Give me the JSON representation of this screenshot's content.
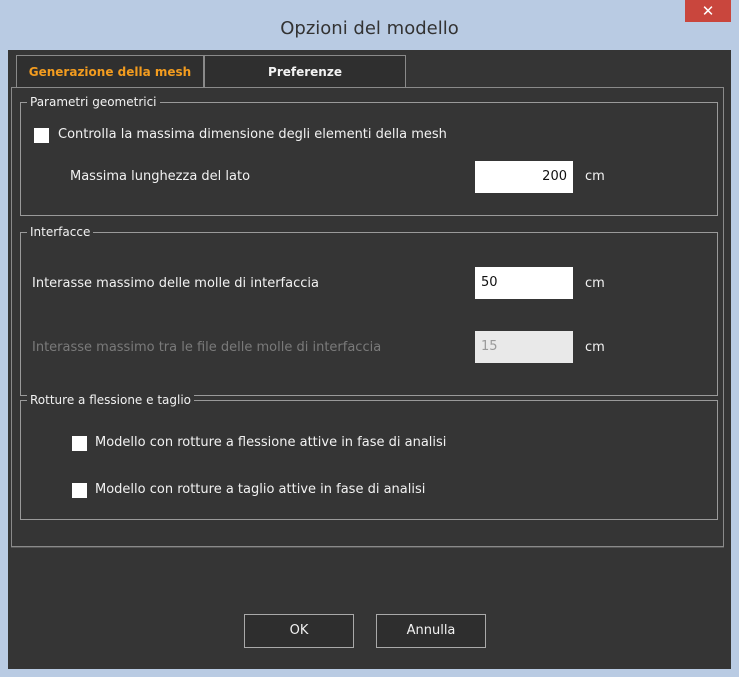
{
  "window": {
    "title": "Opzioni del modello",
    "close_glyph": "✕"
  },
  "tabs": [
    {
      "label": "Generazione della mesh",
      "active": true
    },
    {
      "label": "Preferenze",
      "active": false
    }
  ],
  "groups": {
    "geometric": {
      "legend": "Parametri geometrici",
      "checkbox_label": "Controlla la massima dimensione degli elementi della mesh",
      "max_side_label": "Massima lunghezza del lato",
      "max_side_value": "200",
      "max_side_unit": "cm"
    },
    "interfaces": {
      "legend": "Interfacce",
      "spacing_label": "Interasse massimo delle molle di interfaccia",
      "spacing_value": "50",
      "spacing_unit": "cm",
      "rows_label": "Interasse massimo tra le file delle molle di interfaccia",
      "rows_value": "15",
      "rows_unit": "cm"
    },
    "breaks": {
      "legend": "Rotture a flessione e taglio",
      "flex_label": "Modello con rotture a flessione attive in fase di analisi",
      "shear_label": "Modello con rotture a taglio attive in fase di analisi"
    }
  },
  "buttons": {
    "ok": "OK",
    "cancel": "Annulla"
  }
}
